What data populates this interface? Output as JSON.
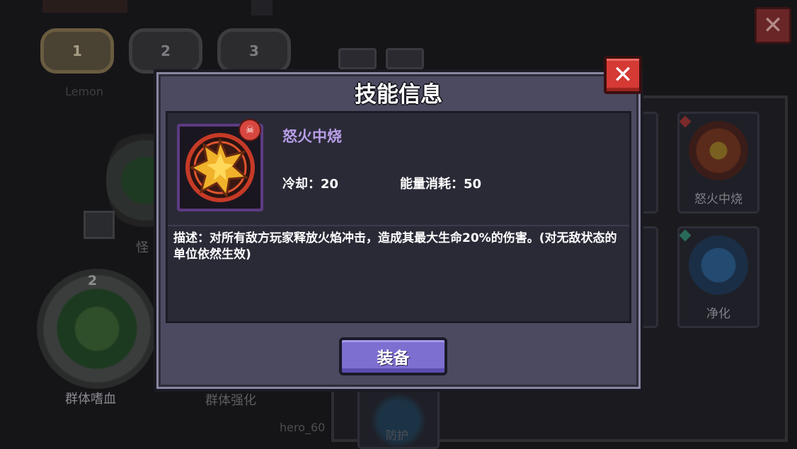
{
  "background": {
    "slot_tabs": [
      "1",
      "2",
      "3"
    ],
    "player_name": "Lemon",
    "close_label": "✕",
    "skill_cards": [
      {
        "label": "怒火中烧"
      },
      {
        "label": "净化"
      }
    ],
    "emblem_level": "2",
    "labels": {
      "bloodthirst": "群体嗜血",
      "group_buff": "群体强化",
      "monster": "怪",
      "hero": "hero_60",
      "bottom_card": "防护"
    }
  },
  "dialog": {
    "title": "技能信息",
    "close_label": "✕",
    "skill": {
      "name": "怒火中烧",
      "badge": "☠",
      "cooldown_label": "冷却：20",
      "energy_label": "能量消耗：50",
      "description": "描述：对所有敌方玩家释放火焰冲击，造成其最大生命20%的伤害。(对无敌状态的单位依然生效)"
    },
    "equip_button": "装备"
  },
  "colors": {
    "dialog_bg": "#4b4a60",
    "content_bg": "#2a2a37",
    "skill_name": "#b79ee6",
    "close_red": "#d53a35",
    "equip_purple": "#7d6fd0"
  }
}
